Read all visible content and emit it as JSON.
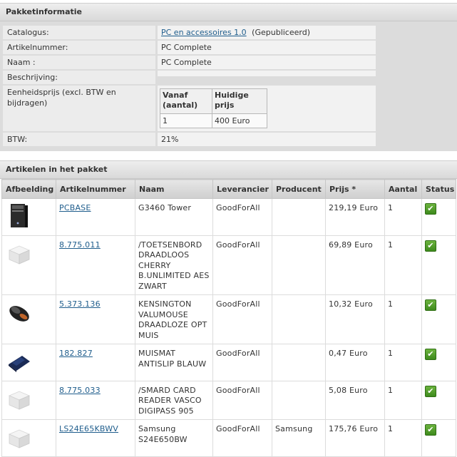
{
  "package_info": {
    "title": "Pakketinformatie",
    "catalogus_label": "Catalogus:",
    "catalogus_link": "PC en accessoires 1.0",
    "catalogus_status": "(Gepubliceerd)",
    "artikelnummer_label": "Artikelnummer:",
    "artikelnummer_value": "PC Complete",
    "naam_label": "Naam :",
    "naam_value": "PC Complete",
    "beschrijving_label": "Beschrijving:",
    "beschrijving_value": "",
    "eenheidsprijs_label": "Eenheidsprijs (excl. BTW en bijdragen)",
    "price_table": {
      "header_vanaf": "Vanaf (aantal)",
      "header_prijs": "Huidige prijs",
      "vanaf": "1",
      "prijs": "400 Euro"
    },
    "btw_label": "BTW:",
    "btw_value": "21%"
  },
  "articles": {
    "title": "Artikelen in het pakket",
    "columns": [
      "Afbeelding",
      "Artikelnummer",
      "Naam",
      "Leverancier",
      "Producent",
      "Prijs *",
      "Aantal",
      "Status"
    ],
    "rows": [
      {
        "image": "pc-tower-icon",
        "artikelnummer": "PCBASE",
        "naam": "G3460 Tower",
        "leverancier": "GoodForAll",
        "producent": "",
        "prijs": "219,19 Euro",
        "aantal": "1",
        "status": "ok-check-icon"
      },
      {
        "image": "product-box-placeholder-icon",
        "artikelnummer": "8.775.011",
        "naam": "/TOETSENBORD DRAADLOOS CHERRY B.UNLIMITED AES ZWART",
        "leverancier": "GoodForAll",
        "producent": "",
        "prijs": "69,89 Euro",
        "aantal": "1",
        "status": "ok-check-icon"
      },
      {
        "image": "mouse-icon",
        "artikelnummer": "5.373.136",
        "naam": "KENSINGTON VALUMOUSE DRAADLOZE OPT MUIS",
        "leverancier": "GoodForAll",
        "producent": "",
        "prijs": "10,32 Euro",
        "aantal": "1",
        "status": "ok-check-icon"
      },
      {
        "image": "mousepad-icon",
        "artikelnummer": "182.827",
        "naam": "MUISMAT ANTISLIP BLAUW",
        "leverancier": "GoodForAll",
        "producent": "",
        "prijs": "0,47 Euro",
        "aantal": "1",
        "status": "ok-check-icon"
      },
      {
        "image": "product-box-placeholder-icon",
        "artikelnummer": "8.775.033",
        "naam": "/SMARD CARD READER VASCO DIGIPASS 905",
        "leverancier": "GoodForAll",
        "producent": "",
        "prijs": "5,08 Euro",
        "aantal": "1",
        "status": "ok-check-icon"
      },
      {
        "image": "product-box-placeholder-icon",
        "artikelnummer": "LS24E65KBWV",
        "naam": "Samsung S24E650BW",
        "leverancier": "GoodForAll",
        "producent": "Samsung",
        "prijs": "175,76 Euro",
        "aantal": "1",
        "status": "ok-check-icon"
      }
    ]
  },
  "colors": {
    "link": "#1f5d8c",
    "status_ok": "#4a9a24"
  }
}
